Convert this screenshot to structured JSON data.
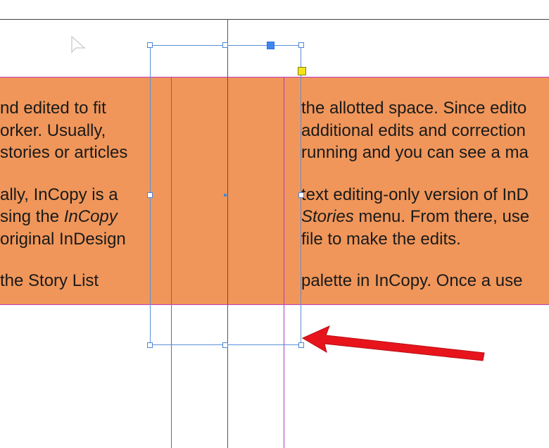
{
  "left_column": {
    "para1": [
      "nd edited to fit",
      "orker. Usually,",
      " stories or articles"
    ],
    "para2_line1": "ally, InCopy is a",
    "para2_line2_prefix": "sing the ",
    "para2_line2_italic": "InCopy",
    "para2_line3": "original InDesign",
    "para3": [
      "the Story List"
    ]
  },
  "right_column": {
    "para1": [
      "the allotted space. Since edito",
      "additional edits and correction",
      "running and you can see a ma"
    ],
    "para2_line1": "text editing-only version of InD",
    "para2_line2_italic": "Stories",
    "para2_line2_suffix": " menu. From there, use",
    "para2_line3": "file to make the edits.",
    "para3": [
      "palette in InCopy. Once a use"
    ]
  },
  "colors": {
    "text_frame_fill": "#F0965A",
    "selection": "#5B8FD6",
    "guide": "#B03CC8",
    "annotation_arrow": "#E8141C",
    "overflow_port": "#F5E31A"
  },
  "icons": {
    "cursor": "arrow-pointer-icon",
    "annotation": "red-arrow-icon"
  }
}
